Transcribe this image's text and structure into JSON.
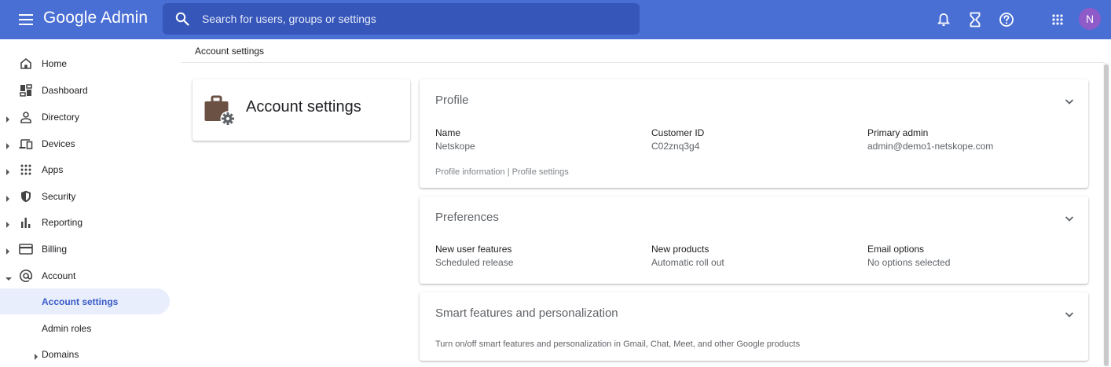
{
  "header": {
    "brand": "Google Admin",
    "search_placeholder": "Search for users, groups or settings",
    "avatar_initial": "N",
    "colors": {
      "bar": "#4a6fd4",
      "search": "#3656b9",
      "avatar": "#8e5bc9"
    },
    "icons": [
      "menu-icon",
      "search-icon",
      "bell-icon",
      "hourglass-icon",
      "help-icon",
      "apps-grid-icon"
    ]
  },
  "sidebar": {
    "items": [
      {
        "label": "Home",
        "icon": "home-icon"
      },
      {
        "label": "Dashboard",
        "icon": "dashboard-icon"
      },
      {
        "label": "Directory",
        "icon": "person-icon"
      },
      {
        "label": "Devices",
        "icon": "devices-icon"
      },
      {
        "label": "Apps",
        "icon": "apps-icon"
      },
      {
        "label": "Security",
        "icon": "shield-icon"
      },
      {
        "label": "Reporting",
        "icon": "bar-chart-icon"
      },
      {
        "label": "Billing",
        "icon": "credit-card-icon"
      },
      {
        "label": "Account",
        "icon": "at-icon"
      },
      {
        "label": "Account settings"
      },
      {
        "label": "Admin roles"
      },
      {
        "label": "Domains"
      }
    ]
  },
  "breadcrumb": "Account settings",
  "title_card": {
    "title": "Account settings"
  },
  "profile": {
    "title": "Profile",
    "fields": [
      {
        "label": "Name",
        "value": "Netskope"
      },
      {
        "label": "Customer ID",
        "value": "C02znq3g4"
      },
      {
        "label": "Primary admin",
        "value": "admin@demo1-netskope.com"
      }
    ],
    "link1": "Profile information",
    "separator": "|",
    "link2": "Profile settings"
  },
  "preferences": {
    "title": "Preferences",
    "fields": [
      {
        "label": "New user features",
        "value": "Scheduled release"
      },
      {
        "label": "New products",
        "value": "Automatic roll out"
      },
      {
        "label": "Email options",
        "value": "No options selected"
      }
    ]
  },
  "smart": {
    "title": "Smart features and personalization",
    "description": "Turn on/off smart features and personalization in Gmail, Chat, Meet, and other Google products"
  }
}
